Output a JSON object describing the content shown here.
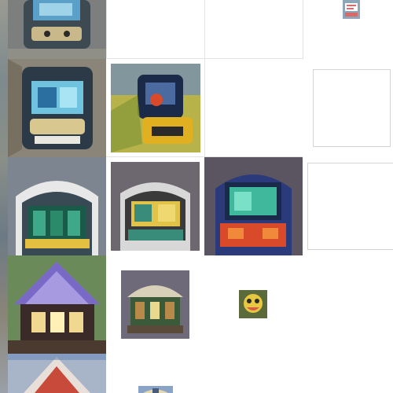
{
  "grid": {
    "rows": 5,
    "columns": 4,
    "background": "#ffffff",
    "line_color": "#e3e3e3",
    "frame_color": "#d4d4d4"
  },
  "thumbnails": [
    {
      "name": "thumb-r1-c1",
      "subject": "arcade-machine",
      "palette": [
        "#7c7f7d",
        "#3e4a52",
        "#5aa0c8",
        "#c9b98a"
      ]
    },
    {
      "name": "thumb-r1-c4",
      "subject": "tiny-sign",
      "palette": [
        "#8fa6b8",
        "#d86a6a",
        "#ffffff"
      ]
    },
    {
      "name": "thumb-r2-c1",
      "subject": "arcade-machine",
      "palette": [
        "#8a8578",
        "#2c3a48",
        "#6fc3de",
        "#d8c890"
      ]
    },
    {
      "name": "thumb-r2-c2",
      "subject": "yellow-vehicle",
      "palette": [
        "#b7b24a",
        "#1c2a4a",
        "#e0b020",
        "#6a8cc0"
      ]
    },
    {
      "name": "thumb-r3-c1",
      "subject": "bus-front",
      "palette": [
        "#7d8590",
        "#1a5a48",
        "#e3c040",
        "#e8e8e8"
      ]
    },
    {
      "name": "thumb-r3-c2",
      "subject": "bus-front",
      "palette": [
        "#6d6870",
        "#e2c34a",
        "#3a8c7a",
        "#d8d8d8"
      ]
    },
    {
      "name": "thumb-r3-c3",
      "subject": "bus-front",
      "palette": [
        "#5a5560",
        "#3fb89c",
        "#d84a2a",
        "#2a3a7a"
      ]
    },
    {
      "name": "thumb-r4-c1",
      "subject": "pavilion",
      "palette": [
        "#6b8a5a",
        "#7a6ac8",
        "#f0d890",
        "#3a2a28"
      ]
    },
    {
      "name": "thumb-r4-c2",
      "subject": "pavilion",
      "palette": [
        "#6f6a7a",
        "#d8d0b8",
        "#3a5a3a",
        "#b88a4a"
      ]
    },
    {
      "name": "thumb-r4-c3",
      "subject": "small-object",
      "palette": [
        "#5a6a3a",
        "#e8c840",
        "#d85a4a",
        "#2a2a2a"
      ]
    },
    {
      "name": "thumb-r5-c1",
      "subject": "roof",
      "palette": [
        "#a8b4c8",
        "#c84a3a",
        "#e8e0d8",
        "#6a8ab8"
      ]
    },
    {
      "name": "thumb-r5-c2",
      "subject": "partial-object",
      "palette": [
        "#8aa4c8",
        "#e8d8b0",
        "#4a5a7a"
      ]
    }
  ],
  "empty_frames": [
    {
      "name": "empty-frame-r2-c4"
    },
    {
      "name": "empty-frame-r3-c4"
    }
  ]
}
